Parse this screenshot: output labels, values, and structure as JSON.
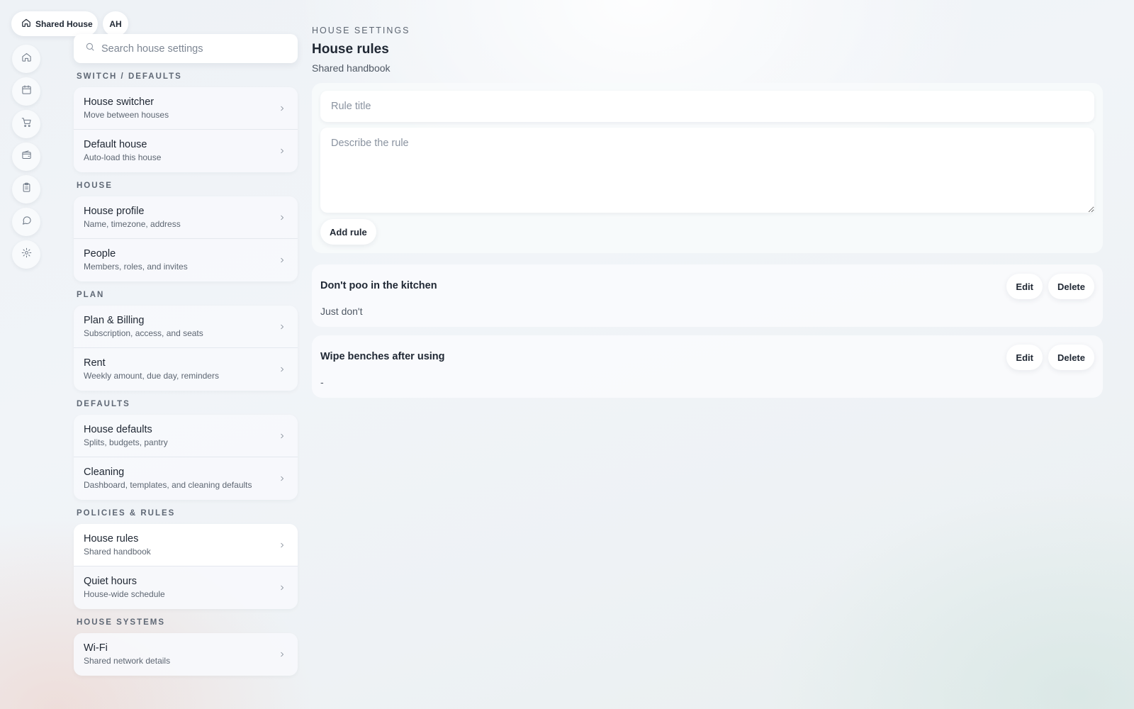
{
  "topbar": {
    "house_label": "Shared House",
    "avatar_initials": "AH"
  },
  "rail": {
    "items": [
      "home-icon",
      "calendar-icon",
      "cart-icon",
      "wallet-icon",
      "clipboard-icon",
      "chat-icon",
      "gear-icon"
    ]
  },
  "search": {
    "placeholder": "Search house settings"
  },
  "sidebar": {
    "groups": [
      {
        "label": "SWITCH / DEFAULTS",
        "items": [
          {
            "title": "House switcher",
            "subtitle": "Move between houses"
          },
          {
            "title": "Default house",
            "subtitle": "Auto-load this house"
          }
        ]
      },
      {
        "label": "HOUSE",
        "items": [
          {
            "title": "House profile",
            "subtitle": "Name, timezone, address"
          },
          {
            "title": "People",
            "subtitle": "Members, roles, and invites"
          }
        ]
      },
      {
        "label": "PLAN",
        "items": [
          {
            "title": "Plan & Billing",
            "subtitle": "Subscription, access, and seats"
          },
          {
            "title": "Rent",
            "subtitle": "Weekly amount, due day, reminders"
          }
        ]
      },
      {
        "label": "DEFAULTS",
        "items": [
          {
            "title": "House defaults",
            "subtitle": "Splits, budgets, pantry"
          },
          {
            "title": "Cleaning",
            "subtitle": "Dashboard, templates, and cleaning defaults"
          }
        ]
      },
      {
        "label": "POLICIES & RULES",
        "items": [
          {
            "title": "House rules",
            "subtitle": "Shared handbook",
            "active": true
          },
          {
            "title": "Quiet hours",
            "subtitle": "House-wide schedule"
          }
        ]
      },
      {
        "label": "HOUSE SYSTEMS",
        "items": [
          {
            "title": "Wi-Fi",
            "subtitle": "Shared network details"
          }
        ]
      }
    ]
  },
  "main": {
    "eyebrow": "HOUSE SETTINGS",
    "title": "House rules",
    "subtitle": "Shared handbook",
    "form": {
      "title_placeholder": "Rule title",
      "title_value": "",
      "desc_placeholder": "Describe the rule",
      "desc_value": "",
      "add_label": "Add rule"
    },
    "rules": [
      {
        "title": "Don't poo in the kitchen",
        "description": "Just don't",
        "edit_label": "Edit",
        "delete_label": "Delete"
      },
      {
        "title": "Wipe benches after using",
        "description": "-",
        "edit_label": "Edit",
        "delete_label": "Delete"
      }
    ]
  }
}
